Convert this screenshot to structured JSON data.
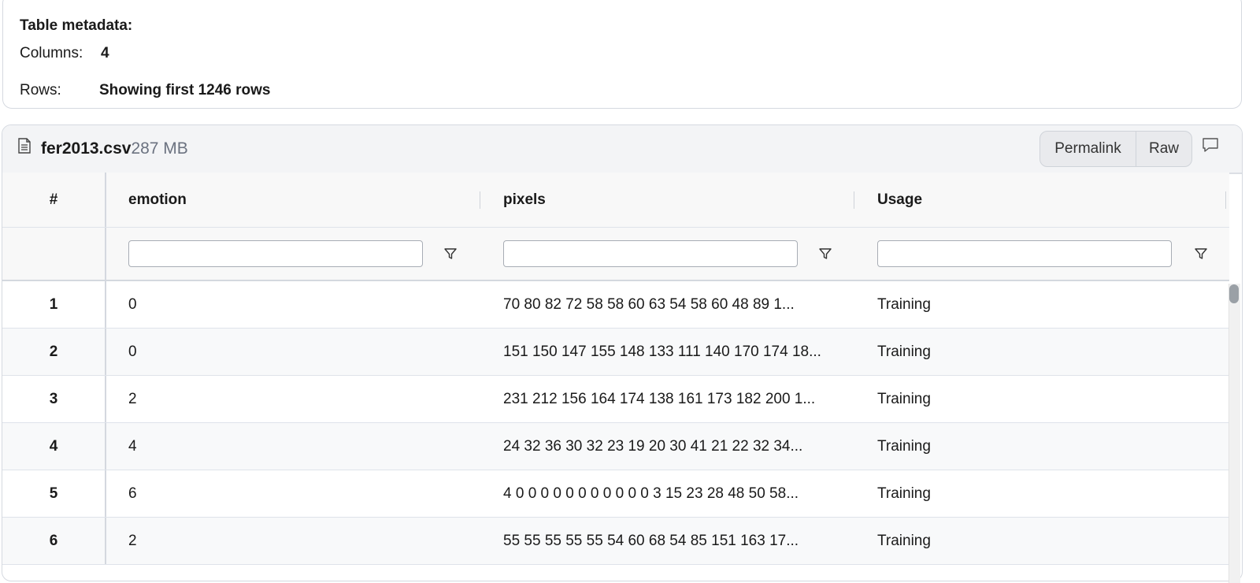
{
  "metadata": {
    "title": "Table metadata:",
    "columns_label": "Columns:",
    "columns_value": "4",
    "rows_label": "Rows:",
    "rows_value": "Showing first 1246 rows"
  },
  "file": {
    "icon": "file-text-icon",
    "name": "fer2013.csv",
    "size": "287 MB",
    "permalink_label": "Permalink",
    "raw_label": "Raw",
    "comment_icon": "comment-icon"
  },
  "table": {
    "columns": [
      "#",
      "emotion",
      "pixels",
      "Usage"
    ],
    "filter_icon": "filter-icon",
    "rows": [
      [
        "1",
        "0",
        "70 80 82 72 58 58 60 63 54 58 60 48 89 1...",
        "Training"
      ],
      [
        "2",
        "0",
        "151 150 147 155 148 133 111 140 170 174 18...",
        "Training"
      ],
      [
        "3",
        "2",
        "231 212 156 164 174 138 161 173 182 200 1...",
        "Training"
      ],
      [
        "4",
        "4",
        "24 32 36 30 32 23 19 20 30 41 21 22 32 34...",
        "Training"
      ],
      [
        "5",
        "6",
        "4 0 0 0 0 0 0 0 0 0 0 0 3 15 23 28 48 50 58...",
        "Training"
      ],
      [
        "6",
        "2",
        "55 55 55 55 55 54 60 68 54 85 151 163 17...",
        "Training"
      ]
    ]
  },
  "colors": {
    "border": "#d5d9e0",
    "header_bg": "#f3f4f6",
    "scroll_thumb": "#9aa0a6"
  }
}
